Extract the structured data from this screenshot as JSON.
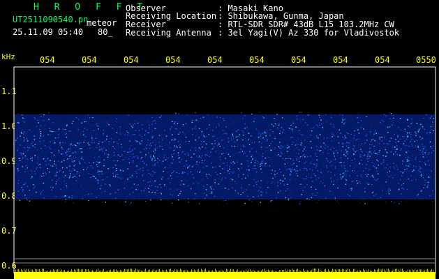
{
  "header": {
    "title": "H R O F F T",
    "file_name": "UT2511090540.pn",
    "file_suffix": "meteor",
    "datetime": "25.11.09 05:40",
    "count": "80_",
    "info": [
      {
        "label": "Observer",
        "value": ": Masaki Kano"
      },
      {
        "label": "Receiving Location",
        "value": ": Shibukawa, Gunma, Japan"
      },
      {
        "label": "Receiver",
        "value": ": RTL-SDR SDR# 43dB L15 103.2MHz CW"
      },
      {
        "label": "Receiving Antenna",
        "value": ": 3el Yagi(V) Az 330 for Vladivostok"
      }
    ]
  },
  "axis": {
    "unit": "kHz",
    "time_labels": [
      "054",
      "054",
      "054",
      "054",
      "054",
      "054",
      "054",
      "054",
      "054",
      "0550"
    ],
    "freq_labels": [
      "1.1",
      "1.0",
      "0.9",
      "0.8",
      "0.7",
      "0.6"
    ]
  },
  "colors": {
    "background": "#000000",
    "header_text": "#ffffff",
    "title_text": "#00ff66",
    "tick_text": "#ffff00",
    "band_low": "#0a2a8a",
    "band_mid": "#1f5fff",
    "band_high": "#3fd8ff",
    "strip": "#ffff00"
  }
}
